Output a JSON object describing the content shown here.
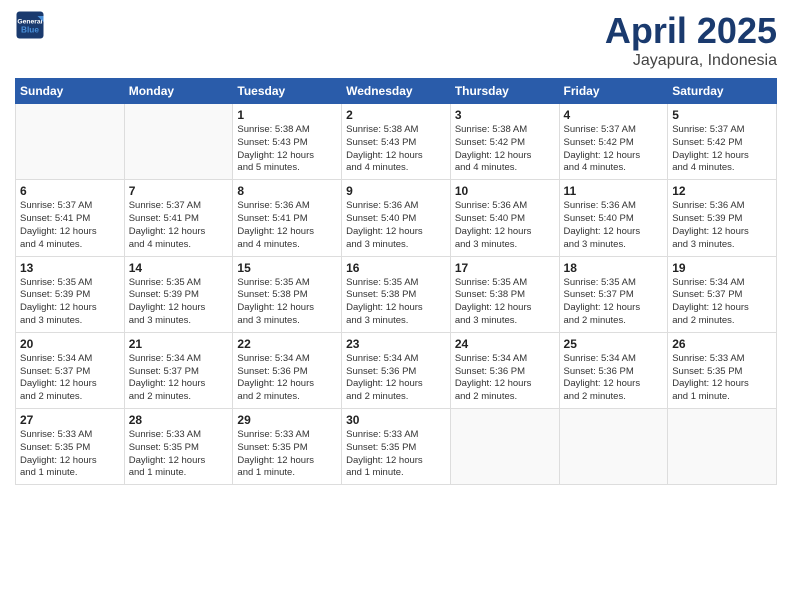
{
  "logo": {
    "line1": "General",
    "line2": "Blue"
  },
  "title": "April 2025",
  "subtitle": "Jayapura, Indonesia",
  "weekdays": [
    "Sunday",
    "Monday",
    "Tuesday",
    "Wednesday",
    "Thursday",
    "Friday",
    "Saturday"
  ],
  "weeks": [
    [
      {
        "day": "",
        "info": ""
      },
      {
        "day": "",
        "info": ""
      },
      {
        "day": "1",
        "info": "Sunrise: 5:38 AM\nSunset: 5:43 PM\nDaylight: 12 hours\nand 5 minutes."
      },
      {
        "day": "2",
        "info": "Sunrise: 5:38 AM\nSunset: 5:43 PM\nDaylight: 12 hours\nand 4 minutes."
      },
      {
        "day": "3",
        "info": "Sunrise: 5:38 AM\nSunset: 5:42 PM\nDaylight: 12 hours\nand 4 minutes."
      },
      {
        "day": "4",
        "info": "Sunrise: 5:37 AM\nSunset: 5:42 PM\nDaylight: 12 hours\nand 4 minutes."
      },
      {
        "day": "5",
        "info": "Sunrise: 5:37 AM\nSunset: 5:42 PM\nDaylight: 12 hours\nand 4 minutes."
      }
    ],
    [
      {
        "day": "6",
        "info": "Sunrise: 5:37 AM\nSunset: 5:41 PM\nDaylight: 12 hours\nand 4 minutes."
      },
      {
        "day": "7",
        "info": "Sunrise: 5:37 AM\nSunset: 5:41 PM\nDaylight: 12 hours\nand 4 minutes."
      },
      {
        "day": "8",
        "info": "Sunrise: 5:36 AM\nSunset: 5:41 PM\nDaylight: 12 hours\nand 4 minutes."
      },
      {
        "day": "9",
        "info": "Sunrise: 5:36 AM\nSunset: 5:40 PM\nDaylight: 12 hours\nand 3 minutes."
      },
      {
        "day": "10",
        "info": "Sunrise: 5:36 AM\nSunset: 5:40 PM\nDaylight: 12 hours\nand 3 minutes."
      },
      {
        "day": "11",
        "info": "Sunrise: 5:36 AM\nSunset: 5:40 PM\nDaylight: 12 hours\nand 3 minutes."
      },
      {
        "day": "12",
        "info": "Sunrise: 5:36 AM\nSunset: 5:39 PM\nDaylight: 12 hours\nand 3 minutes."
      }
    ],
    [
      {
        "day": "13",
        "info": "Sunrise: 5:35 AM\nSunset: 5:39 PM\nDaylight: 12 hours\nand 3 minutes."
      },
      {
        "day": "14",
        "info": "Sunrise: 5:35 AM\nSunset: 5:39 PM\nDaylight: 12 hours\nand 3 minutes."
      },
      {
        "day": "15",
        "info": "Sunrise: 5:35 AM\nSunset: 5:38 PM\nDaylight: 12 hours\nand 3 minutes."
      },
      {
        "day": "16",
        "info": "Sunrise: 5:35 AM\nSunset: 5:38 PM\nDaylight: 12 hours\nand 3 minutes."
      },
      {
        "day": "17",
        "info": "Sunrise: 5:35 AM\nSunset: 5:38 PM\nDaylight: 12 hours\nand 3 minutes."
      },
      {
        "day": "18",
        "info": "Sunrise: 5:35 AM\nSunset: 5:37 PM\nDaylight: 12 hours\nand 2 minutes."
      },
      {
        "day": "19",
        "info": "Sunrise: 5:34 AM\nSunset: 5:37 PM\nDaylight: 12 hours\nand 2 minutes."
      }
    ],
    [
      {
        "day": "20",
        "info": "Sunrise: 5:34 AM\nSunset: 5:37 PM\nDaylight: 12 hours\nand 2 minutes."
      },
      {
        "day": "21",
        "info": "Sunrise: 5:34 AM\nSunset: 5:37 PM\nDaylight: 12 hours\nand 2 minutes."
      },
      {
        "day": "22",
        "info": "Sunrise: 5:34 AM\nSunset: 5:36 PM\nDaylight: 12 hours\nand 2 minutes."
      },
      {
        "day": "23",
        "info": "Sunrise: 5:34 AM\nSunset: 5:36 PM\nDaylight: 12 hours\nand 2 minutes."
      },
      {
        "day": "24",
        "info": "Sunrise: 5:34 AM\nSunset: 5:36 PM\nDaylight: 12 hours\nand 2 minutes."
      },
      {
        "day": "25",
        "info": "Sunrise: 5:34 AM\nSunset: 5:36 PM\nDaylight: 12 hours\nand 2 minutes."
      },
      {
        "day": "26",
        "info": "Sunrise: 5:33 AM\nSunset: 5:35 PM\nDaylight: 12 hours\nand 1 minute."
      }
    ],
    [
      {
        "day": "27",
        "info": "Sunrise: 5:33 AM\nSunset: 5:35 PM\nDaylight: 12 hours\nand 1 minute."
      },
      {
        "day": "28",
        "info": "Sunrise: 5:33 AM\nSunset: 5:35 PM\nDaylight: 12 hours\nand 1 minute."
      },
      {
        "day": "29",
        "info": "Sunrise: 5:33 AM\nSunset: 5:35 PM\nDaylight: 12 hours\nand 1 minute."
      },
      {
        "day": "30",
        "info": "Sunrise: 5:33 AM\nSunset: 5:35 PM\nDaylight: 12 hours\nand 1 minute."
      },
      {
        "day": "",
        "info": ""
      },
      {
        "day": "",
        "info": ""
      },
      {
        "day": "",
        "info": ""
      }
    ]
  ]
}
